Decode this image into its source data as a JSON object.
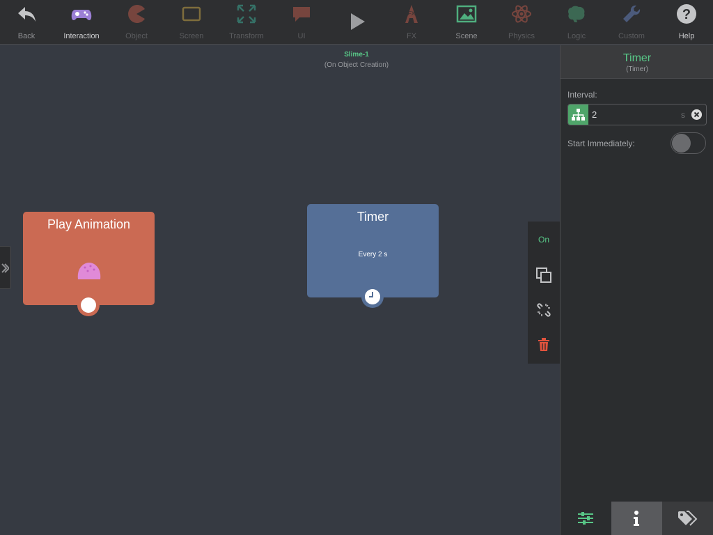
{
  "toolbar": {
    "items": [
      {
        "label": "Back",
        "icon": "back-arrow-icon",
        "enabled": true
      },
      {
        "label": "Interaction",
        "icon": "gamepad-icon",
        "enabled": true
      },
      {
        "label": "Object",
        "icon": "pacman-icon",
        "enabled": false
      },
      {
        "label": "Screen",
        "icon": "screen-icon",
        "enabled": false
      },
      {
        "label": "Transform",
        "icon": "transform-icon",
        "enabled": false
      },
      {
        "label": "UI",
        "icon": "speech-bubble-icon",
        "enabled": false
      },
      {
        "label": "",
        "icon": "play-icon",
        "enabled": true
      },
      {
        "label": "FX",
        "icon": "fx-icon",
        "enabled": false
      },
      {
        "label": "Scene",
        "icon": "image-icon",
        "enabled": true
      },
      {
        "label": "Physics",
        "icon": "atom-icon",
        "enabled": false
      },
      {
        "label": "Logic",
        "icon": "brain-icon",
        "enabled": false
      },
      {
        "label": "Custom",
        "icon": "wrench-icon",
        "enabled": false
      },
      {
        "label": "Help",
        "icon": "help-icon",
        "enabled": true
      }
    ]
  },
  "canvas": {
    "object_name": "Slime-1",
    "event_name": "(On Object Creation)",
    "nodes": {
      "play_animation": {
        "title": "Play Animation",
        "icon": "slime-icon"
      },
      "timer": {
        "title": "Timer",
        "subtitle": "Every 2 s",
        "icon": "clock-icon"
      }
    }
  },
  "context_menu": {
    "on_label": "On",
    "items": [
      "duplicate-icon",
      "unlink-icon",
      "trash-icon"
    ]
  },
  "panel": {
    "title": "Timer",
    "subtitle": "(Timer)",
    "interval_label": "Interval:",
    "interval_value": "2",
    "interval_unit": "s",
    "start_label": "Start Immediately:",
    "start_immediately": false,
    "tabs": [
      "settings-icon",
      "info-icon",
      "tags-icon"
    ],
    "active_tab": 1
  },
  "colors": {
    "accent_green": "#58c787",
    "node_orange": "#cb6a53",
    "node_blue": "#556f97",
    "delete_red": "#e2533d"
  }
}
